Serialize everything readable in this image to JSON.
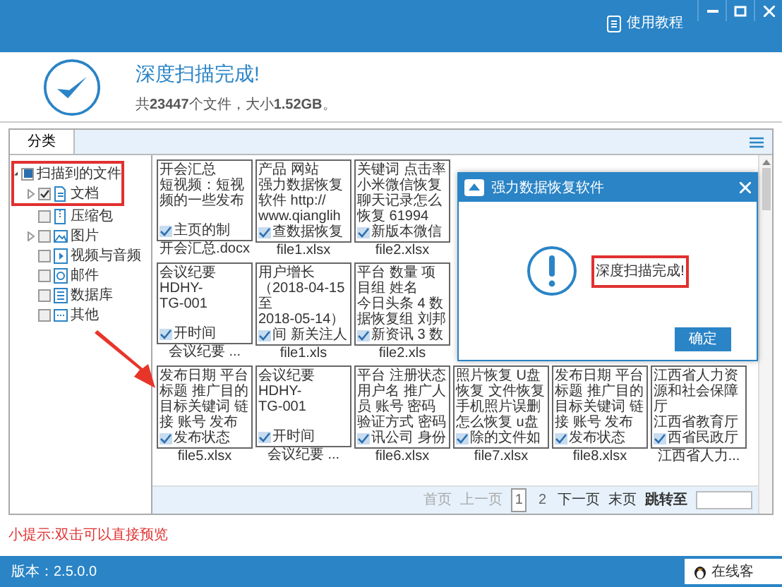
{
  "titlebar": {
    "help_label": "使用教程"
  },
  "summary": {
    "title": "深度扫描完成!",
    "parts": [
      "共",
      "**23447**",
      "个文件，大小",
      "**1.52GB**",
      "。"
    ]
  },
  "tabs": [
    {
      "label": "分类",
      "selected": true
    }
  ],
  "tree": [
    {
      "label": "扫描到的文件",
      "checked": false,
      "indeterminate": true,
      "expanded": true,
      "highlighted": true,
      "children": [
        {
          "label": "文档",
          "checked": true,
          "kind": "document",
          "expanded": false,
          "highlighted": true
        },
        {
          "label": "压缩包",
          "checked": false,
          "kind": "archive",
          "highlighted": false
        },
        {
          "label": "图片",
          "checked": false,
          "kind": "image",
          "expanded": false,
          "highlighted": false
        },
        {
          "label": "视频与音频",
          "checked": false,
          "kind": "video",
          "highlighted": false
        },
        {
          "label": "邮件",
          "checked": false,
          "kind": "mail",
          "highlighted": false
        },
        {
          "label": "数据库",
          "checked": false,
          "kind": "database",
          "highlighted": false
        },
        {
          "label": "其他",
          "checked": false,
          "kind": "other",
          "highlighted": false
        }
      ]
    }
  ],
  "annotation_arrow": true,
  "files": [
    [
      {
        "lines": [
          "开会汇总",
          "短视频：短视",
          "频的一些发布"
        ],
        "footer": "主页的制",
        "caption": "开会汇总.docx"
      },
      {
        "lines": [
          "产品 网站",
          "强力数据恢复",
          "软件 http://",
          "www.qianglih"
        ],
        "footer": "查数据恢复",
        "caption": "file1.xlsx"
      },
      {
        "lines": [
          "关键词 点击率",
          "小米微信恢复",
          "聊天记录怎么",
          "恢复 61994"
        ],
        "footer": "新版本微信",
        "caption": "file2.xlsx"
      }
    ],
    [
      {
        "lines": [
          "会议纪要",
          "HDHY-",
          "TG-001"
        ],
        "footer": "开时间",
        "caption": "会议纪要 ..."
      },
      {
        "lines": [
          "用户增长",
          "（2018-04-15",
          "至",
          "2018-05-14）"
        ],
        "footer": "间 新关注人",
        "caption": "file1.xls"
      },
      {
        "lines": [
          "平台 数量 项",
          "目组 姓名",
          "今日头条 4 数",
          "据恢复组 刘邦"
        ],
        "footer": "新资讯 3 数",
        "caption": "file2.xls"
      }
    ],
    [
      {
        "lines": [
          "发布日期 平台",
          "标题 推广目的",
          "目标关键词 链",
          "接 账号 发布"
        ],
        "footer": "发布状态",
        "caption": "file5.xlsx"
      },
      {
        "lines": [
          "会议纪要",
          "HDHY-",
          "TG-001"
        ],
        "footer": "开时间",
        "caption": "会议纪要 ..."
      },
      {
        "lines": [
          "平台 注册状态",
          "用户名 推广人",
          "员 账号 密码",
          "验证方式 密码"
        ],
        "footer": "讯公司 身份",
        "caption": "file6.xlsx"
      },
      {
        "lines": [
          "照片恢复 U盘",
          "恢复 文件恢复",
          "手机照片误删",
          "怎么恢复 u盘"
        ],
        "footer": "除的文件如",
        "caption": "file7.xlsx"
      },
      {
        "lines": [
          "发布日期 平台",
          "标题 推广目的",
          "目标关键词 链",
          "接 账号 发布"
        ],
        "footer": "发布状态",
        "caption": "file8.xlsx"
      },
      {
        "lines": [
          "江西省人力资",
          "源和社会保障",
          "厅",
          "江西省教育厅"
        ],
        "footer": "西省民政厅",
        "caption": "江西省人力..."
      }
    ]
  ],
  "pagination": [
    {
      "label": "首页",
      "kind": "link",
      "disabled": true
    },
    {
      "label": "上一页",
      "kind": "link",
      "disabled": true
    },
    {
      "label": "1",
      "kind": "page",
      "selected": true
    },
    {
      "label": "2",
      "kind": "page",
      "selected": false
    },
    {
      "label": "下一页",
      "kind": "link",
      "disabled": false
    },
    {
      "label": "末页",
      "kind": "link",
      "disabled": false
    },
    {
      "label": "跳转至",
      "kind": "jump"
    }
  ],
  "dialog": {
    "title": "强力数据恢复软件",
    "message": "深度扫描完成!",
    "message_highlighted": true,
    "button": "确定"
  },
  "hint": "小提示:双击可以直接预览",
  "footer": {
    "version": "版本：2.5.0.0",
    "support": "在线客"
  }
}
